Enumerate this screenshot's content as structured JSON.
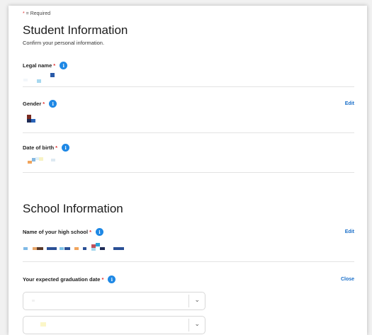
{
  "required_note": {
    "star": "*",
    "text": " = Required"
  },
  "student": {
    "title": "Student Information",
    "subtitle": "Confirm your personal information.",
    "fields": {
      "legal_name": {
        "label": "Legal name",
        "star": "*",
        "info": "i"
      },
      "gender": {
        "label": "Gender",
        "star": "*",
        "info": "i",
        "action": "Edit"
      },
      "dob": {
        "label": "Date of birth",
        "star": "*",
        "info": "i"
      }
    }
  },
  "school": {
    "title": "School Information",
    "fields": {
      "high_school": {
        "label": "Name of your high school",
        "star": "*",
        "info": "i",
        "action": "Edit"
      },
      "graduation": {
        "label": "Your expected graduation date",
        "star": "*",
        "info": "i",
        "action": "Close"
      }
    },
    "selects": [
      {
        "value": ""
      },
      {
        "value": ""
      }
    ]
  },
  "icons": {
    "chevron": "chevron-down-icon",
    "info": "info-icon"
  },
  "colors": {
    "accent": "#1e88e5",
    "link": "#1a6fc9",
    "required": "#e02f2f"
  }
}
